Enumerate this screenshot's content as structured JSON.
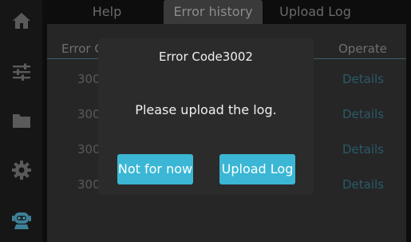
{
  "sidebar": {
    "items": [
      {
        "icon": "home-icon"
      },
      {
        "icon": "sliders-icon"
      },
      {
        "icon": "folder-icon"
      },
      {
        "icon": "gear-icon"
      },
      {
        "icon": "robot-icon"
      }
    ]
  },
  "tabs": [
    {
      "label": "Help"
    },
    {
      "label": "Error history",
      "active": true
    },
    {
      "label": "Upload Log"
    }
  ],
  "table": {
    "headers": {
      "code": "Error C",
      "operate": "Operate"
    },
    "rows": [
      {
        "code": "300",
        "action": "Details"
      },
      {
        "code": "300",
        "action": "Details"
      },
      {
        "code": "300",
        "action": "Details"
      },
      {
        "code": "300",
        "action": "Details"
      }
    ]
  },
  "dialog": {
    "title": "Error Code3002",
    "message": "Please upload the log.",
    "cancel_label": "Not for now",
    "confirm_label": "Upload Log"
  },
  "colors": {
    "accent": "#3bb7d5",
    "dialog_bg": "#2b2b2b",
    "sidebar_bg": "#161616"
  }
}
